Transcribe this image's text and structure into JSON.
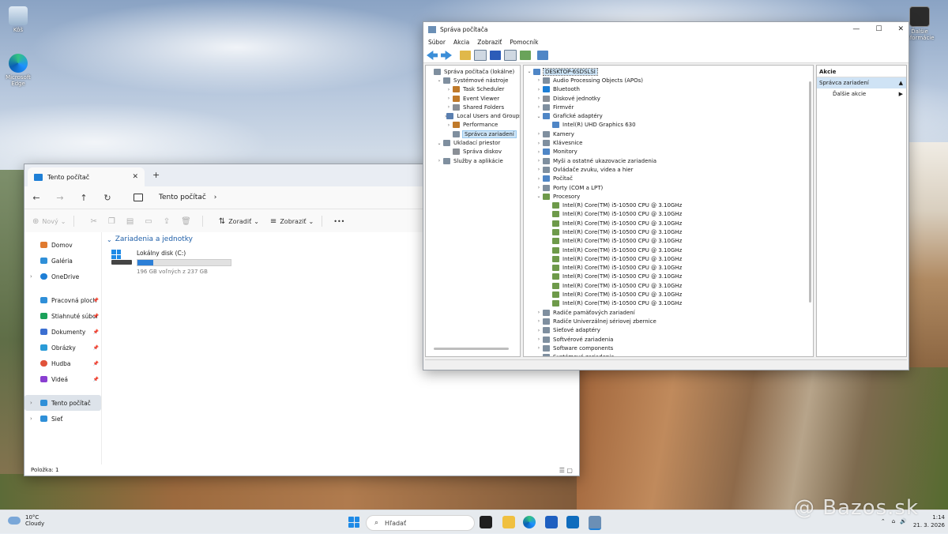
{
  "desktop": {
    "icons": [
      {
        "label": "Kôš"
      },
      {
        "label": "Microsoft Edge"
      },
      {
        "label": "Ďalšie informácie"
      }
    ]
  },
  "explorer": {
    "tab_title": "Tento počítač",
    "address": "Tento počítač",
    "commands": {
      "new": "Nový",
      "sort": "Zoradiť",
      "view": "Zobraziť",
      "more": "•••"
    },
    "sidebar": [
      {
        "label": "Domov",
        "color": "#e07a2f"
      },
      {
        "label": "Galéria",
        "color": "#2f8fd8"
      },
      {
        "label": "OneDrive",
        "color": "#1e7fd6"
      },
      {
        "label": "Pracovná ploch",
        "color": "#2f8fd8"
      },
      {
        "label": "Stiahnuté súbor",
        "color": "#1aa15a"
      },
      {
        "label": "Dokumenty",
        "color": "#3b6fd1"
      },
      {
        "label": "Obrázky",
        "color": "#2a9bd7"
      },
      {
        "label": "Hudba",
        "color": "#e0523a"
      },
      {
        "label": "Videá",
        "color": "#8a3fd1"
      },
      {
        "label": "Tento počítač",
        "color": "#2f8fd8"
      },
      {
        "label": "Sieť",
        "color": "#2f8fd8"
      }
    ],
    "group_title": "Zariadenia a jednotky",
    "drive": {
      "name": "Lokálny disk (C:)",
      "detail": "196 GB voľných z 237 GB",
      "used_fraction": 0.17
    },
    "status": "Položka: 1"
  },
  "devmgr": {
    "title": "Správa počítača",
    "menu": [
      "Súbor",
      "Akcia",
      "Zobraziť",
      "Pomocník"
    ],
    "left_tree": [
      {
        "label": "Správa počítača (lokálne)",
        "level": 0,
        "exp": ""
      },
      {
        "label": "Systémové nástroje",
        "level": 1,
        "exp": "v"
      },
      {
        "label": "Task Scheduler",
        "level": 2,
        "exp": ">"
      },
      {
        "label": "Event Viewer",
        "level": 2,
        "exp": ">"
      },
      {
        "label": "Shared Folders",
        "level": 2,
        "exp": ">"
      },
      {
        "label": "Local Users and Groups",
        "level": 2,
        "exp": ">"
      },
      {
        "label": "Performance",
        "level": 2,
        "exp": ">"
      },
      {
        "label": "Správca zariadení",
        "level": 2,
        "exp": "",
        "selected": true
      },
      {
        "label": "Ukladací priestor",
        "level": 1,
        "exp": "v"
      },
      {
        "label": "Správa diskov",
        "level": 2,
        "exp": ""
      },
      {
        "label": "Služby a aplikácie",
        "level": 1,
        "exp": ">"
      }
    ],
    "device_tree": [
      {
        "label": "DESKTOP-6SDSLSI",
        "level": 0,
        "exp": "v",
        "root": true
      },
      {
        "label": "Audio Processing Objects (APOs)",
        "level": 1,
        "exp": ">"
      },
      {
        "label": "Bluetooth",
        "level": 1,
        "exp": ">"
      },
      {
        "label": "Diskové jednotky",
        "level": 1,
        "exp": ">"
      },
      {
        "label": "Firmvér",
        "level": 1,
        "exp": ">"
      },
      {
        "label": "Grafické adaptéry",
        "level": 1,
        "exp": "v"
      },
      {
        "label": "Intel(R) UHD Graphics 630",
        "level": 2,
        "exp": ""
      },
      {
        "label": "Kamery",
        "level": 1,
        "exp": ">"
      },
      {
        "label": "Klávesnice",
        "level": 1,
        "exp": ">"
      },
      {
        "label": "Monitory",
        "level": 1,
        "exp": ">"
      },
      {
        "label": "Myši a ostatné ukazovacie zariadenia",
        "level": 1,
        "exp": ">"
      },
      {
        "label": "Ovládače zvuku, videa a hier",
        "level": 1,
        "exp": ">"
      },
      {
        "label": "Počítač",
        "level": 1,
        "exp": ">"
      },
      {
        "label": "Porty (COM a LPT)",
        "level": 1,
        "exp": ">"
      },
      {
        "label": "Procesory",
        "level": 1,
        "exp": "v"
      },
      {
        "label": "Intel(R) Core(TM) i5-10500 CPU @ 3.10GHz",
        "level": 2,
        "exp": ""
      },
      {
        "label": "Intel(R) Core(TM) i5-10500 CPU @ 3.10GHz",
        "level": 2,
        "exp": ""
      },
      {
        "label": "Intel(R) Core(TM) i5-10500 CPU @ 3.10GHz",
        "level": 2,
        "exp": ""
      },
      {
        "label": "Intel(R) Core(TM) i5-10500 CPU @ 3.10GHz",
        "level": 2,
        "exp": ""
      },
      {
        "label": "Intel(R) Core(TM) i5-10500 CPU @ 3.10GHz",
        "level": 2,
        "exp": ""
      },
      {
        "label": "Intel(R) Core(TM) i5-10500 CPU @ 3.10GHz",
        "level": 2,
        "exp": ""
      },
      {
        "label": "Intel(R) Core(TM) i5-10500 CPU @ 3.10GHz",
        "level": 2,
        "exp": ""
      },
      {
        "label": "Intel(R) Core(TM) i5-10500 CPU @ 3.10GHz",
        "level": 2,
        "exp": ""
      },
      {
        "label": "Intel(R) Core(TM) i5-10500 CPU @ 3.10GHz",
        "level": 2,
        "exp": ""
      },
      {
        "label": "Intel(R) Core(TM) i5-10500 CPU @ 3.10GHz",
        "level": 2,
        "exp": ""
      },
      {
        "label": "Intel(R) Core(TM) i5-10500 CPU @ 3.10GHz",
        "level": 2,
        "exp": ""
      },
      {
        "label": "Intel(R) Core(TM) i5-10500 CPU @ 3.10GHz",
        "level": 2,
        "exp": ""
      },
      {
        "label": "Radiče pamäťových zariadení",
        "level": 1,
        "exp": ">"
      },
      {
        "label": "Radiče Univerzálnej sériovej zbernice",
        "level": 1,
        "exp": ">"
      },
      {
        "label": "Sieťové adaptéry",
        "level": 1,
        "exp": ">"
      },
      {
        "label": "Softvérové zariadenia",
        "level": 1,
        "exp": ">"
      },
      {
        "label": "Software components",
        "level": 1,
        "exp": ">"
      },
      {
        "label": "Systémové zariadenia",
        "level": 1,
        "exp": ">"
      }
    ],
    "actions": {
      "header": "Akcie",
      "section": "Správca zariadení",
      "more": "Ďalšie akcie"
    }
  },
  "taskbar": {
    "temp": "10°C",
    "weather": "Cloudy",
    "search_placeholder": "Hľadať",
    "time": "1:14",
    "date": "21. 3. 2026"
  },
  "watermark": "@ Bazos.sk"
}
